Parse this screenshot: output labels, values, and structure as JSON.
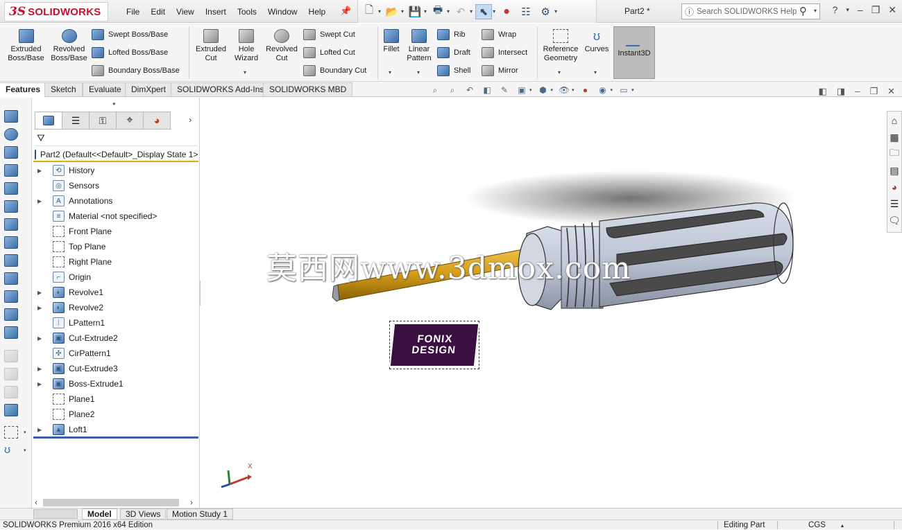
{
  "app": {
    "name": "SOLIDWORKS",
    "document_title": "Part2 *"
  },
  "menu": [
    "File",
    "Edit",
    "View",
    "Insert",
    "Tools",
    "Window",
    "Help"
  ],
  "search": {
    "placeholder": "Search SOLIDWORKS Help"
  },
  "ribbon": {
    "extruded_boss": [
      "Extruded",
      "Boss/Base"
    ],
    "revolved_boss": [
      "Revolved",
      "Boss/Base"
    ],
    "swept_boss": "Swept Boss/Base",
    "lofted_boss": "Lofted Boss/Base",
    "boundary_boss": "Boundary Boss/Base",
    "extruded_cut": [
      "Extruded",
      "Cut"
    ],
    "hole_wizard": [
      "Hole",
      "Wizard"
    ],
    "revolved_cut": [
      "Revolved",
      "Cut"
    ],
    "swept_cut": "Swept Cut",
    "lofted_cut": "Lofted Cut",
    "boundary_cut": "Boundary Cut",
    "fillet": "Fillet",
    "linear_pattern": [
      "Linear",
      "Pattern"
    ],
    "rib": "Rib",
    "draft": "Draft",
    "shell": "Shell",
    "wrap": "Wrap",
    "intersect": "Intersect",
    "mirror": "Mirror",
    "reference_geometry": [
      "Reference",
      "Geometry"
    ],
    "curves": "Curves",
    "instant3d": "Instant3D"
  },
  "tabs": [
    "Features",
    "Sketch",
    "Evaluate",
    "DimXpert",
    "SOLIDWORKS Add-Ins",
    "SOLIDWORKS MBD"
  ],
  "tree": {
    "root": "Part2  (Default<<Default>_Display State 1>)",
    "items": [
      {
        "label": "History",
        "expandable": true,
        "icon": "history-folder"
      },
      {
        "label": "Sensors",
        "expandable": false,
        "icon": "sensors-folder"
      },
      {
        "label": "Annotations",
        "expandable": true,
        "icon": "annotations-folder"
      },
      {
        "label": "Material <not specified>",
        "expandable": false,
        "icon": "material"
      },
      {
        "label": "Front Plane",
        "expandable": false,
        "icon": "plane"
      },
      {
        "label": "Top Plane",
        "expandable": false,
        "icon": "plane"
      },
      {
        "label": "Right Plane",
        "expandable": false,
        "icon": "plane"
      },
      {
        "label": "Origin",
        "expandable": false,
        "icon": "origin"
      },
      {
        "label": "Revolve1",
        "expandable": true,
        "icon": "revolve"
      },
      {
        "label": "Revolve2",
        "expandable": true,
        "icon": "revolve"
      },
      {
        "label": "LPattern1",
        "expandable": false,
        "icon": "linear-pattern"
      },
      {
        "label": "Cut-Extrude2",
        "expandable": true,
        "icon": "cut-extrude"
      },
      {
        "label": "CirPattern1",
        "expandable": false,
        "icon": "circular-pattern"
      },
      {
        "label": "Cut-Extrude3",
        "expandable": true,
        "icon": "cut-extrude"
      },
      {
        "label": "Boss-Extrude1",
        "expandable": true,
        "icon": "boss-extrude"
      },
      {
        "label": "Plane1",
        "expandable": false,
        "icon": "plane"
      },
      {
        "label": "Plane2",
        "expandable": false,
        "icon": "plane"
      },
      {
        "label": "Loft1",
        "expandable": true,
        "icon": "loft"
      }
    ]
  },
  "viewport": {
    "watermark": "莫西网www.3dmox.com",
    "logo_decal": [
      "FONIX",
      "DESIGN"
    ],
    "triad_x_label": "X",
    "colors": {
      "handle": "#4a4a4a",
      "handle_light": "#bfc6d6",
      "shaft": "#d39b16"
    }
  },
  "bottom_tabs": [
    "Model",
    "3D Views",
    "Motion Study 1"
  ],
  "status": {
    "edition": "SOLIDWORKS Premium 2016 x64 Edition",
    "mode": "Editing Part",
    "units": "CGS"
  }
}
